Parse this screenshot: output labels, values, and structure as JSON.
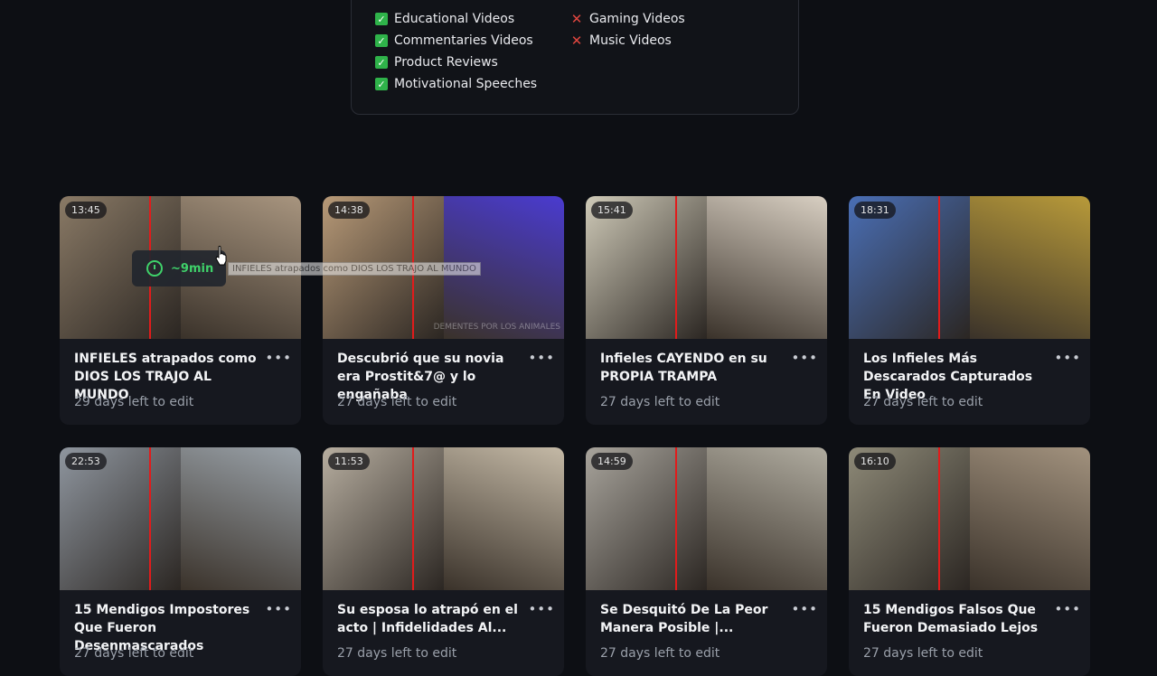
{
  "categories": {
    "allowed": [
      "Educational Videos",
      "Commentaries Videos",
      "Product Reviews",
      "Motivational Speeches"
    ],
    "blocked": [
      "Gaming Videos",
      "Music Videos"
    ]
  },
  "hover": {
    "duration_chip": "~9min",
    "title_tooltip": "INFIELES atrapados como DIOS LOS TRAJO AL MUNDO"
  },
  "videos": [
    {
      "duration": "13:45",
      "title": "INFIELES atrapados como DIOS LOS TRAJO AL MUNDO",
      "status": "29 days left to edit",
      "colors": [
        "#8a7a66",
        "#a8957f"
      ]
    },
    {
      "duration": "14:38",
      "title": "Descubrió que su novia era Prostit&7@ y lo engañaba",
      "status": "27 days left to edit",
      "colors": [
        "#b89a78",
        "#4a3bd0"
      ],
      "watermark": "DEMENTES POR LOS ANIMALES"
    },
    {
      "duration": "15:41",
      "title": "Infieles CAYENDO en su PROPIA TRAMPA",
      "status": "27 days left to edit",
      "colors": [
        "#cfcab8",
        "#d8cfc2"
      ]
    },
    {
      "duration": "18:31",
      "title": "Los Infieles Más Descarados Capturados En Video",
      "status": "27 days left to edit",
      "colors": [
        "#4a6fb6",
        "#b89a3a"
      ]
    },
    {
      "duration": "22:53",
      "title": "15 Mendigos Impostores Que Fueron Desenmascarados",
      "status": "27 days left to edit",
      "colors": [
        "#8f969f",
        "#9aa2a9"
      ]
    },
    {
      "duration": "11:53",
      "title": "Su esposa lo atrapó en el acto | Infidelidades Al...",
      "status": "27 days left to edit",
      "colors": [
        "#b7aea0",
        "#c4b9a6"
      ]
    },
    {
      "duration": "14:59",
      "title": "Se Desquitó De La Peor Manera Posible |...",
      "status": "27 days left to edit",
      "colors": [
        "#a8a49c",
        "#b0aca0"
      ]
    },
    {
      "duration": "16:10",
      "title": "15 Mendigos Falsos Que Fueron Demasiado Lejos",
      "status": "27 days left to edit",
      "colors": [
        "#8e8a78",
        "#a2927e"
      ]
    }
  ]
}
